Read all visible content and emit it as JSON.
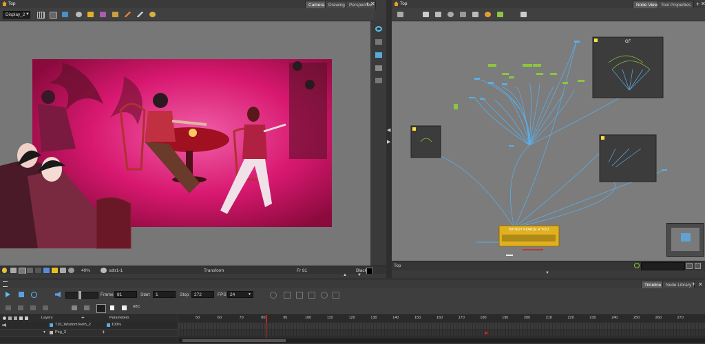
{
  "left_panel": {
    "breadcrumb": "Top",
    "display_select": "Display_2",
    "tabs": [
      "Camera",
      "Drawing",
      "Perspective"
    ],
    "status": {
      "zoom": "40%",
      "layer": "sdtr1-1",
      "tool": "Transform",
      "frame": "Fr 81",
      "color": "Black"
    }
  },
  "right_panel": {
    "breadcrumb": "Top",
    "tabs": [
      "Node View",
      "Tool Properties"
    ],
    "group_label": "GF",
    "composite_label": "I'M NOT FORCE 4 YOU",
    "status_left": "Top"
  },
  "timeline": {
    "tabs": [
      "Timeline",
      "Node Library"
    ],
    "frame_label": "Frame",
    "frame_value": "81",
    "start_label": "Start",
    "start_value": "1",
    "stop_label": "Stop",
    "stop_value": "272",
    "fps_label": "FPS",
    "fps_value": "24",
    "layers_header": "Layers",
    "parameters_header": "Parameters",
    "layers": [
      {
        "name": "T10_WisdomTeeth_2",
        "param": "100%"
      },
      {
        "name": "Peg_3",
        "param": ""
      }
    ],
    "ruler": [
      "50",
      "60",
      "70",
      "80",
      "90",
      "100",
      "110",
      "120",
      "130",
      "140",
      "150",
      "160",
      "170",
      "180",
      "190",
      "200",
      "210",
      "220",
      "230",
      "240",
      "250",
      "260",
      "270"
    ]
  },
  "colors": {
    "accent": "#5aaee8",
    "playhead": "#d02020",
    "composite": "#e0b020",
    "node_green": "#8cc63f"
  }
}
